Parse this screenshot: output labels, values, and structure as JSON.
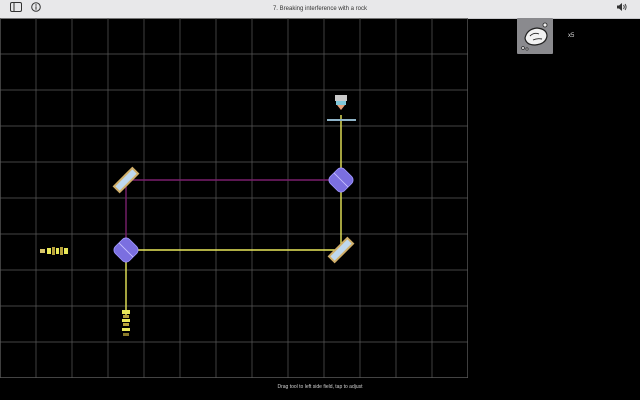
{
  "window": {
    "title": "7. Breaking interference with a rock",
    "menu_icon": "sidebar-icon",
    "info_icon": "info-icon",
    "sound_icon": "speaker-icon"
  },
  "board": {
    "columns": 13,
    "rows": 10,
    "background": "#000000",
    "grid_color": "#5a5a5a"
  },
  "beams": {
    "main_color": "#e9e85a",
    "secondary_color": "#7a1f6e"
  },
  "pieces": [
    {
      "name": "photon-source",
      "icon": "laser-source-icon"
    },
    {
      "name": "beam-splitter-1",
      "icon": "beam-splitter-icon"
    },
    {
      "name": "beam-splitter-2",
      "icon": "beam-splitter-icon"
    },
    {
      "name": "mirror-1",
      "icon": "mirror-icon"
    },
    {
      "name": "mirror-2",
      "icon": "mirror-icon"
    },
    {
      "name": "detector-top",
      "icon": "detector-icon"
    },
    {
      "name": "detector-bottom",
      "icon": "detector-icon"
    },
    {
      "name": "detector-left",
      "icon": "detector-icon"
    }
  ],
  "toolbox": {
    "tool_icon": "rock-icon",
    "count": "x5"
  },
  "instruction": "Drag tool to left side field, tap to adjust",
  "colors": {
    "titlebar": "#e8e8ea",
    "splitter": "#7b6fe0",
    "mirror_frame": "#d2b06a",
    "mirror_glass": "#bfd8ef"
  }
}
